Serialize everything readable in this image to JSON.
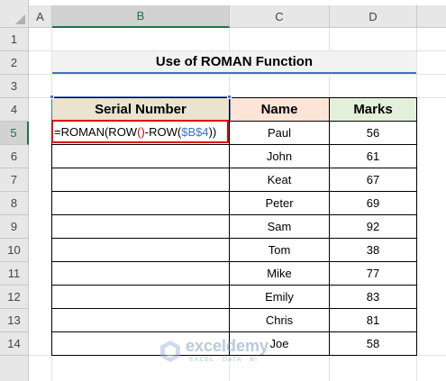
{
  "columns": [
    "A",
    "B",
    "C",
    "D"
  ],
  "rows": [
    "1",
    "2",
    "3",
    "4",
    "5",
    "6",
    "7",
    "8",
    "9",
    "10",
    "11",
    "12",
    "13",
    "14"
  ],
  "title": "Use of ROMAN Function",
  "headers": {
    "serial": "Serial Number",
    "name": "Name",
    "marks": "Marks"
  },
  "formula": {
    "prefix": "=ROMAN(ROW",
    "open_paren": "(",
    "close_paren": ")",
    "middle": "-ROW(",
    "reference": "$B$4",
    "suffix": "))"
  },
  "names": [
    "Paul",
    "John",
    "Keat",
    "Peter",
    "Sam",
    "Tom",
    "Mike",
    "Emily",
    "Chris",
    "Joe"
  ],
  "marks": [
    "56",
    "61",
    "67",
    "69",
    "92",
    "38",
    "77",
    "83",
    "81",
    "58"
  ],
  "watermark": {
    "name": "exceldemy",
    "tagline": "EXCEL · DATA · BI"
  },
  "colors": {
    "accent": "#217346",
    "title_border": "#4472c4",
    "formula_border": "#e00000"
  }
}
